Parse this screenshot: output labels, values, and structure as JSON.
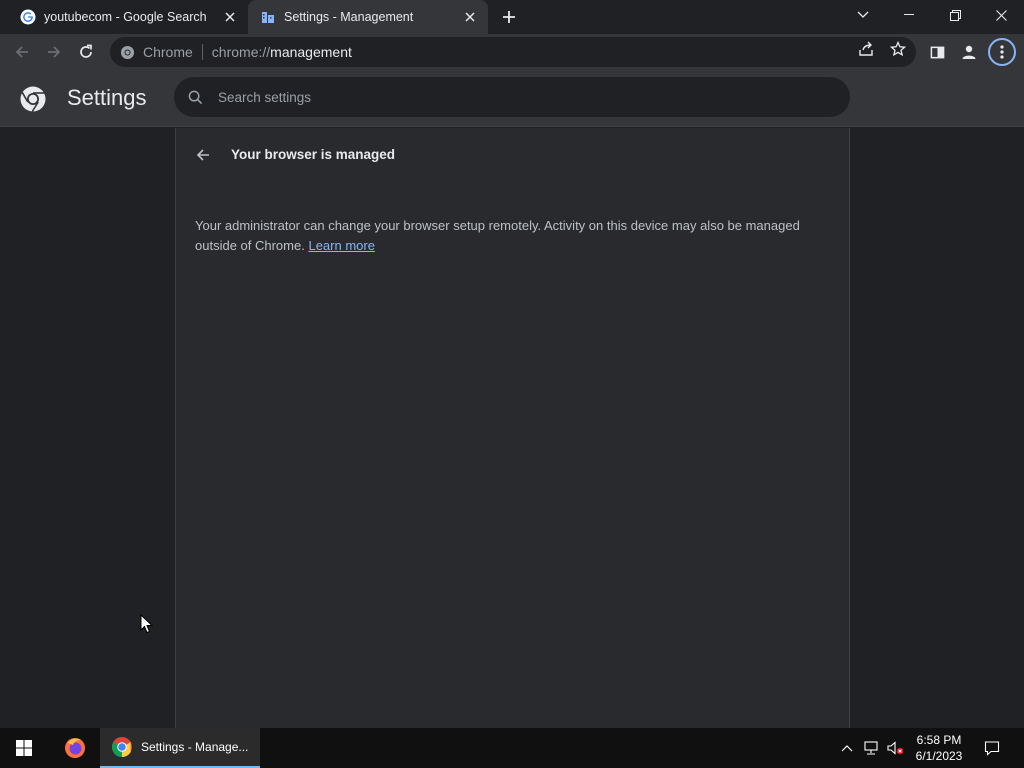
{
  "tabs": [
    {
      "title": "youtubecom - Google Search",
      "icon": "google-icon",
      "active": false
    },
    {
      "title": "Settings - Management",
      "icon": "management-icon",
      "active": true
    }
  ],
  "omnibox": {
    "chip": "Chrome",
    "url_scheme": "chrome://",
    "url_path": "management"
  },
  "settings": {
    "title": "Settings",
    "search_placeholder": "Search settings"
  },
  "page": {
    "heading": "Your browser is managed",
    "description": "Your administrator can change your browser setup remotely. Activity on this device may also be managed outside of Chrome.",
    "learn_more": "Learn more"
  },
  "taskbar": {
    "chrome_label": "Settings - Manage...",
    "time": "6:58 PM",
    "date": "6/1/2023"
  },
  "colors": {
    "accent": "#8ab4f8",
    "background": "#202124",
    "card": "#292a2d",
    "toolbar": "#35363a"
  }
}
